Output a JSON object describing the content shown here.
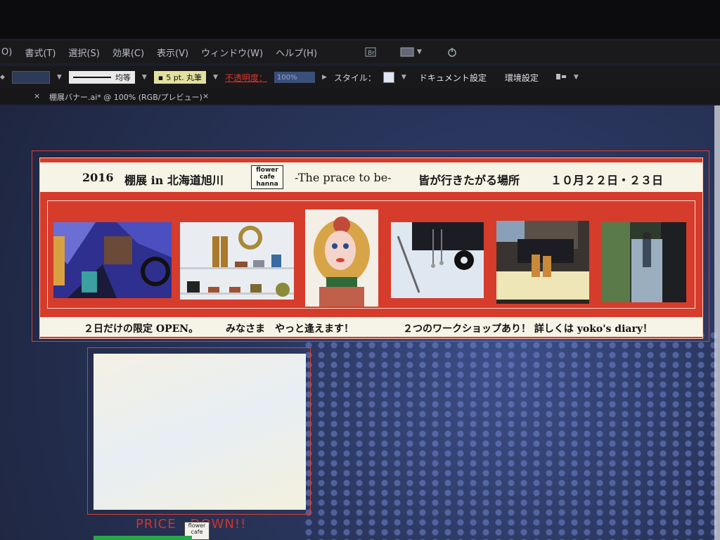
{
  "menubar": {
    "items": [
      "O)",
      "書式(T)",
      "選択(S)",
      "効果(C)",
      "表示(V)",
      "ウィンドウ(W)",
      "ヘルプ(H)"
    ]
  },
  "controlbar": {
    "stroke_profile_label": "均等",
    "brush_label": "5 pt. 丸筆",
    "opacity_label": "不透明度：",
    "opacity_value": "100%",
    "style_label": "スタイル：",
    "document_setup_label": "ドキュメント設定",
    "preferences_label": "環境設定"
  },
  "tabbar": {
    "close_symbol": "×",
    "tab_title": "棚展バナー.ai* @ 100% (RGB/プレビュー)"
  },
  "banner": {
    "year": "2016",
    "event": "棚展 in 北海道旭川",
    "logo": [
      "flower",
      "cafe",
      "hanna"
    ],
    "tagline": "-The prace to be-",
    "tagline_jp": "皆が行きたがる場所",
    "dates": "１０月２２日・２３日",
    "bottom_1": "２日だけの限定 OPEN。",
    "bottom_2": "みなさま　やっと逢えます！",
    "bottom_3": "２つのワークショップあり！ 詳しくは yoko's diary！"
  },
  "artboard2": {
    "price_part1": "PRICE",
    "price_part2": "DOWN!!",
    "mini_logo": [
      "flower",
      "cafe"
    ]
  },
  "colors": {
    "banner_red": "#d63c2b",
    "banner_cream": "#f6f4e6",
    "outline_red": "#d8402f",
    "price_red": "#d1342a"
  }
}
